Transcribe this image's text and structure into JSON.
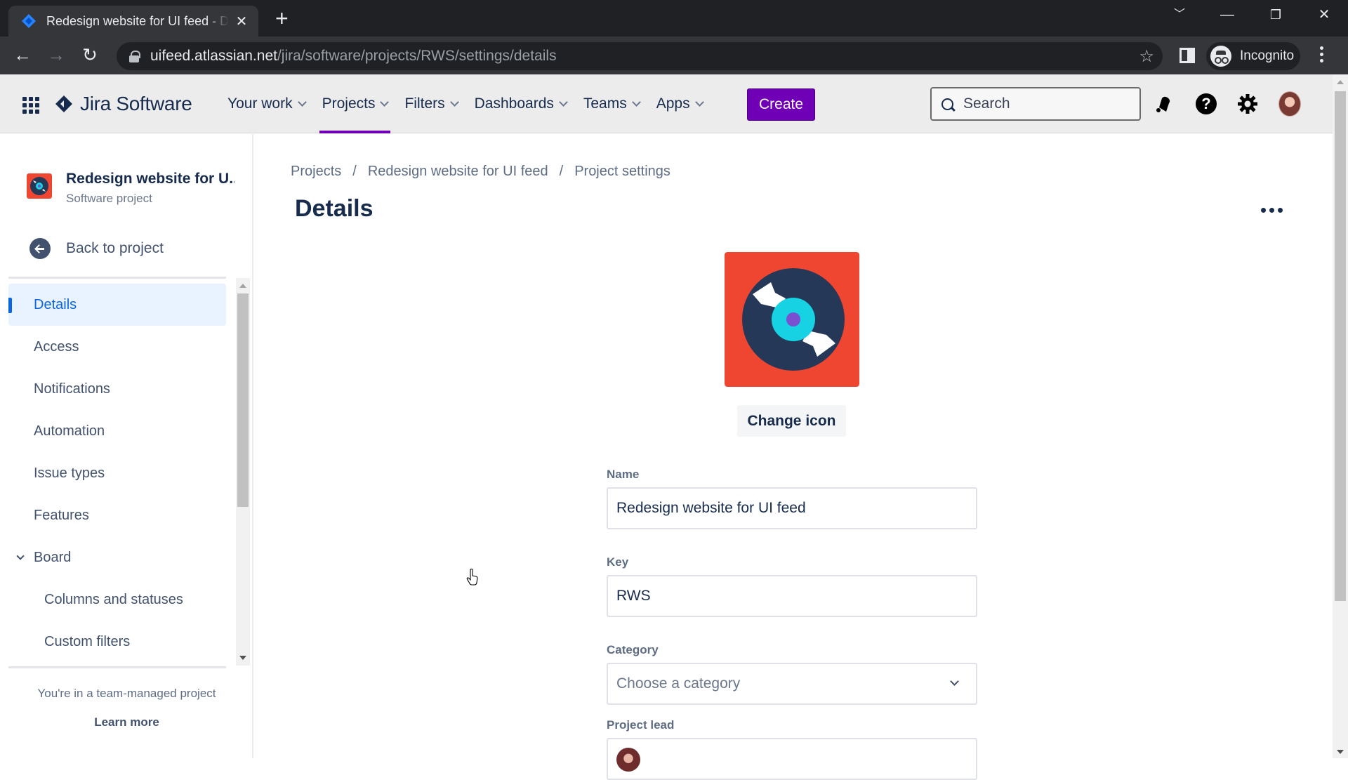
{
  "browser": {
    "tab_title": "Redesign website for UI feed - Details",
    "url_host": "uifeed.atlassian.net",
    "url_path": "/jira/software/projects/RWS/settings/details",
    "profile_label": "Incognito"
  },
  "topnav": {
    "product": "Jira Software",
    "items": [
      {
        "label": "Your work",
        "active": false
      },
      {
        "label": "Projects",
        "active": true
      },
      {
        "label": "Filters",
        "active": false
      },
      {
        "label": "Dashboards",
        "active": false
      },
      {
        "label": "Teams",
        "active": false
      },
      {
        "label": "Apps",
        "active": false
      }
    ],
    "create_label": "Create",
    "search_placeholder": "Search",
    "accent_color": "#6f00b5"
  },
  "sidebar": {
    "project_name": "Redesign website for U...",
    "project_type": "Software project",
    "back_label": "Back to project",
    "items": [
      {
        "label": "Details",
        "active": true
      },
      {
        "label": "Access"
      },
      {
        "label": "Notifications"
      },
      {
        "label": "Automation"
      },
      {
        "label": "Issue types"
      },
      {
        "label": "Features"
      },
      {
        "label": "Board",
        "expanded": true
      },
      {
        "label": "Columns and statuses",
        "sub": true
      },
      {
        "label": "Custom filters",
        "sub": true
      }
    ],
    "team_note": "You're in a team-managed project",
    "learn_more": "Learn more"
  },
  "main": {
    "breadcrumb": [
      "Projects",
      "Redesign website for UI feed",
      "Project settings"
    ],
    "title": "Details",
    "change_icon_label": "Change icon",
    "fields": {
      "name_label": "Name",
      "name_value": "Redesign website for UI feed",
      "key_label": "Key",
      "key_value": "RWS",
      "category_label": "Category",
      "category_placeholder": "Choose a category",
      "lead_label": "Project lead"
    },
    "icon_colors": {
      "background": "#ef4631",
      "disc": "#253858",
      "label": "#16d2e3",
      "hole": "#7a4fd0"
    }
  }
}
